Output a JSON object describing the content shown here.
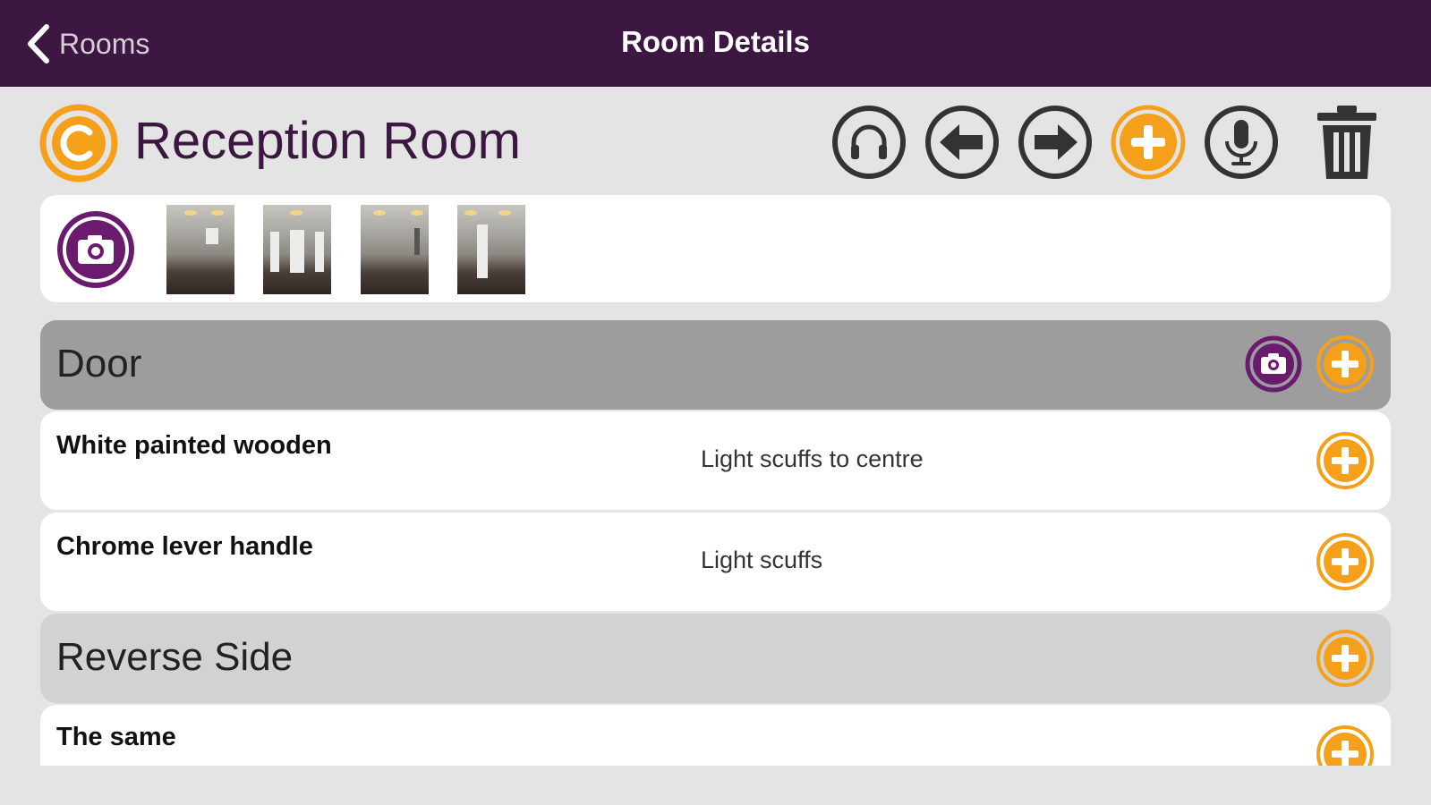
{
  "nav": {
    "back_label": "Rooms",
    "title": "Room Details"
  },
  "room": {
    "name": "Reception Room",
    "icon": "copyright-c-icon"
  },
  "toolbar": {
    "icons": [
      "headphones-icon",
      "arrow-left-icon",
      "arrow-right-icon",
      "add-icon",
      "microphone-icon",
      "trash-icon"
    ]
  },
  "photos": {
    "count": 4,
    "camera_icon": "camera-icon"
  },
  "sections": [
    {
      "title": "Door",
      "items": [
        {
          "name": "White painted wooden",
          "condition": "Light scuffs to centre"
        },
        {
          "name": "Chrome lever handle",
          "condition": "Light scuffs"
        }
      ]
    },
    {
      "title": "Reverse Side",
      "items": [
        {
          "name": "The same",
          "condition": ""
        }
      ]
    }
  ],
  "colors": {
    "brand_purple": "#3c1741",
    "accent_orange": "#f5a01a",
    "icon_gray": "#333333"
  }
}
